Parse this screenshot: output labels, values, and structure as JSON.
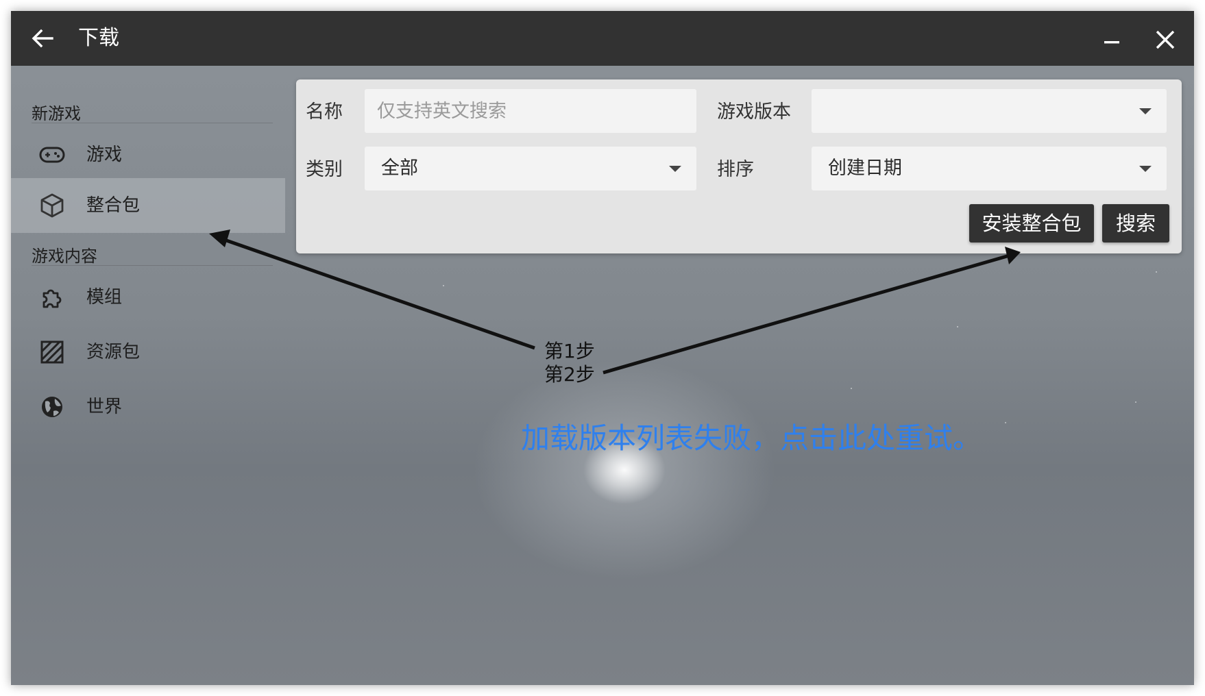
{
  "window": {
    "title": "下载"
  },
  "icons": {
    "back": "arrow-left-icon",
    "minimize": "minimize-icon",
    "close": "close-icon"
  },
  "sidebar": {
    "sections": [
      {
        "header": "新游戏",
        "items": [
          {
            "label": "游戏",
            "icon": "gamepad-icon",
            "selected": false
          },
          {
            "label": "整合包",
            "icon": "package-icon",
            "selected": true
          }
        ]
      },
      {
        "header": "游戏内容",
        "items": [
          {
            "label": "模组",
            "icon": "puzzle-icon",
            "selected": false
          },
          {
            "label": "资源包",
            "icon": "texture-icon",
            "selected": false
          },
          {
            "label": "世界",
            "icon": "globe-icon",
            "selected": false
          }
        ]
      }
    ]
  },
  "search": {
    "name_label": "名称",
    "name_placeholder": "仅支持英文搜索",
    "name_value": "",
    "version_label": "游戏版本",
    "version_value": "",
    "category_label": "类别",
    "category_value": "全部",
    "sort_label": "排序",
    "sort_value": "创建日期",
    "install_button": "安装整合包",
    "search_button": "搜索"
  },
  "main": {
    "error_message": "加载版本列表失败，点击此处重试。"
  },
  "annotation": {
    "step1": "第1步",
    "step2": "第2步"
  },
  "colors": {
    "titlebar": "#323232",
    "link": "#2f80ed",
    "button": "#323232"
  }
}
